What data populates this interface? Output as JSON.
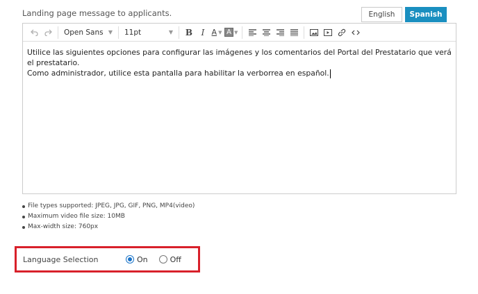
{
  "heading": "Landing page message to applicants.",
  "language_tabs": [
    {
      "label": "English",
      "active": false
    },
    {
      "label": "Spanish",
      "active": true
    }
  ],
  "toolbar": {
    "font_family": "Open Sans",
    "font_size": "11pt",
    "bold_label": "B",
    "italic_label": "I",
    "text_color_label": "A",
    "bg_color_label": "A",
    "icons": [
      "undo-icon",
      "redo-icon",
      "align-left-icon",
      "align-center-icon",
      "align-right-icon",
      "align-justify-icon",
      "image-icon",
      "video-icon",
      "link-icon",
      "code-icon"
    ]
  },
  "editor_content": {
    "line1": "Utilice las siguientes opciones para configurar las imágenes y los comentarios del Portal del Prestatario que verá el prestatario.",
    "line2": "Como administrador, utilice esta pantalla para habilitar la verborrea en español."
  },
  "notes": [
    "File types supported: JPEG, JPG, GIF, PNG, MP4(video)",
    "Maximum video file size: 10MB",
    "Max-width size: 760px"
  ],
  "language_selection": {
    "label": "Language Selection",
    "options": [
      {
        "label": "On",
        "selected": true
      },
      {
        "label": "Off",
        "selected": false
      }
    ]
  },
  "colors": {
    "accent": "#1a8fc0",
    "highlight_border": "#d8202a",
    "radio_selected": "#1a73c8"
  }
}
